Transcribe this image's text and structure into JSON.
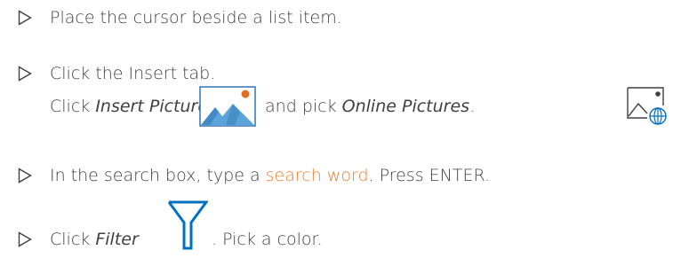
{
  "steps": [
    {
      "text": "Place the cursor beside a list item."
    },
    {
      "text": "Click the Insert tab.",
      "sub": {
        "click_prefix": "Click ",
        "insert_pictures": "Insert Pictures",
        "and_pick": " and pick ",
        "online_pictures": "Online Pictures",
        "period": "."
      }
    },
    {
      "prefix": "In the search box, type a ",
      "highlight": "search word",
      "suffix": ". Press ENTER."
    },
    {
      "click_prefix": "Click ",
      "filter": "Filter",
      "suffix": ". Pick a color."
    }
  ],
  "icons": {
    "bullet": "triangle-outline-bullet",
    "insert_pictures": "insert-pictures-icon",
    "online_pictures": "online-pictures-icon",
    "filter": "filter-funnel-icon"
  },
  "colors": {
    "text": "#404040",
    "highlight": "#ED7D31",
    "picture_fill": "#5BA4D9",
    "picture_dark": "#2E75B6",
    "sun": "#E07020",
    "filter_blue": "#0070C0"
  }
}
